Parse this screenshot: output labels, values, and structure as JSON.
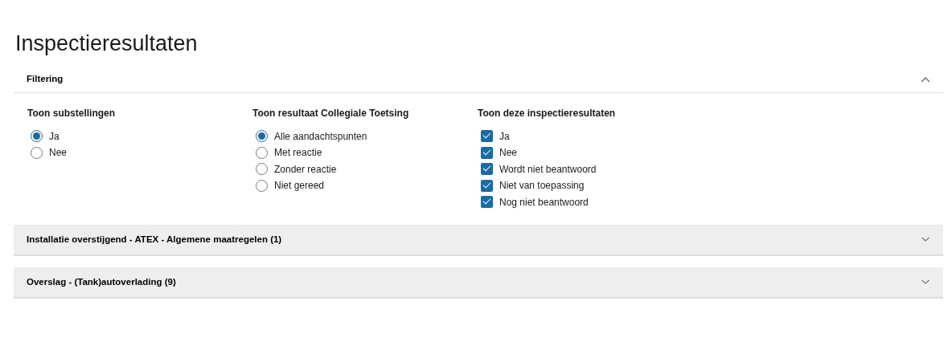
{
  "page_title": "Inspectieresultaten",
  "filter_panel": {
    "title": "Filtering",
    "expanded": true,
    "groups": [
      {
        "kind": "radio",
        "label": "Toon substellingen",
        "options": [
          {
            "label": "Ja",
            "selected": true
          },
          {
            "label": "Nee",
            "selected": false
          }
        ]
      },
      {
        "kind": "radio",
        "label": "Toon resultaat Collegiale Toetsing",
        "options": [
          {
            "label": "Alle aandachtspunten",
            "selected": true
          },
          {
            "label": "Met reactie",
            "selected": false
          },
          {
            "label": "Zonder reactie",
            "selected": false
          },
          {
            "label": "Niet gereed",
            "selected": false
          }
        ]
      },
      {
        "kind": "checkbox",
        "label": "Toon deze inspectieresultaten",
        "options": [
          {
            "label": "Ja",
            "checked": true
          },
          {
            "label": "Nee",
            "checked": true
          },
          {
            "label": "Wordt niet beantwoord",
            "checked": true
          },
          {
            "label": "Niet van toepassing",
            "checked": true
          },
          {
            "label": "Nog niet beantwoord",
            "checked": true
          }
        ]
      }
    ]
  },
  "sections": [
    {
      "title": "Installatie overstijgend - ATEX - Algemene maatregelen (1)",
      "expanded": false
    },
    {
      "title": "Overslag - (Tank)autoverlading (9)",
      "expanded": false
    }
  ]
}
